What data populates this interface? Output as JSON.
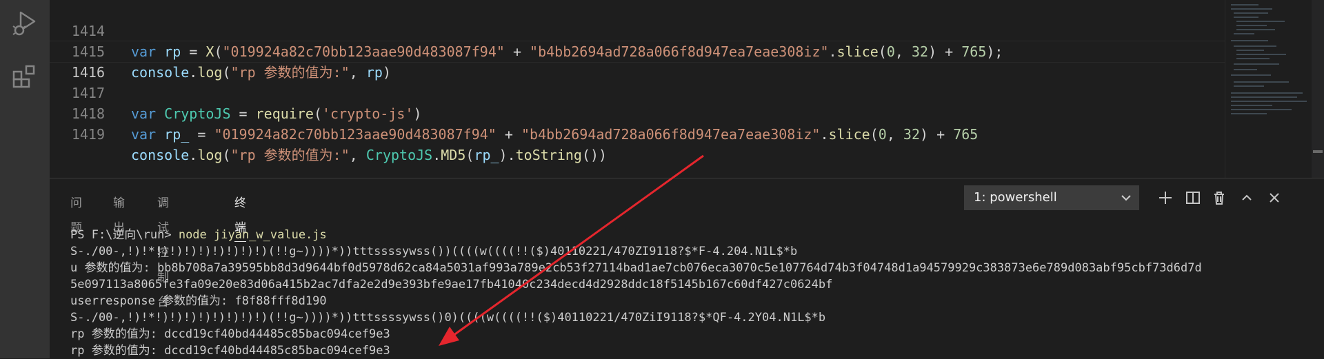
{
  "editor": {
    "lines": [
      {
        "number": "1414",
        "text": "var rp = X(\"019924a82c70bb123aae90d483087f94\" + \"b4bb2694ad728a066f8d947ea7eae308iz\".slice(0, 32) + 765);"
      },
      {
        "number": "1415",
        "text": "console.log(\"rp 参数的值为:\", rp)"
      },
      {
        "number": "1416",
        "text": ""
      },
      {
        "number": "1417",
        "text": "var CryptoJS = require('crypto-js')"
      },
      {
        "number": "1418",
        "text": "var rp_ = \"019924a82c70bb123aae90d483087f94\" + \"b4bb2694ad728a066f8d947ea7eae308iz\".slice(0, 32) + 765"
      },
      {
        "number": "1419",
        "text": "console.log(\"rp 参数的值为:\", CryptoJS.MD5(rp_).toString())"
      }
    ]
  },
  "panel": {
    "tabs": [
      "问题",
      "输出",
      "调试控制台",
      "终端"
    ],
    "active_tab": "终端",
    "terminal_select": "1: powershell",
    "actions": [
      "plus-icon",
      "split-icon",
      "trash-icon",
      "chevron-up-icon",
      "close-icon"
    ]
  },
  "terminal": {
    "prompt": "PS F:\\逆向\\run> ",
    "command": "node jiyan_w_value.js",
    "lines": [
      "S-./00-,!)!*!)!)!)!)!)!)!)!)(!!g~))))*))tttssssywss())((((w((((!!($)40110221/470ZI9118?$*F-4.204.N1L$*b",
      "u 参数的值为: bb8b708a7a39595bb8d3d9644bf0d5978d62ca84a5031af993a789e2cb53f27114bad1ae7cb076eca3070c5e107764d74b3f04748d1a94579929c383873e6e789d083abf95cbf73d6d7d",
      "5e097113a8065fe3fa09e20e83d06a415b2ac7dfa2e2d9e393bfe9ae17fb41040c234decd4d2928ddc18f5145b167c60df427c0624bf",
      "userresponse 参数的值为: f8f88fff8d190",
      "S-./00-,!)!*!)!)!)!)!)!)!)!)(!!g~))))*))tttssssywss()0)((((w((((!!($)40110221/470ZiI9118?$*QF-4.2Y04.N1L$*b",
      "rp 参数的值为: dccd19cf40bd44485c85bac094cef9e3",
      "rp 参数的值为: dccd19cf40bd44485c85bac094cef9e3"
    ]
  },
  "colors": {
    "accent_arrow": "#e5262d",
    "keyword": "#569cd6",
    "string": "#ce9178",
    "number": "#b5cea8"
  }
}
